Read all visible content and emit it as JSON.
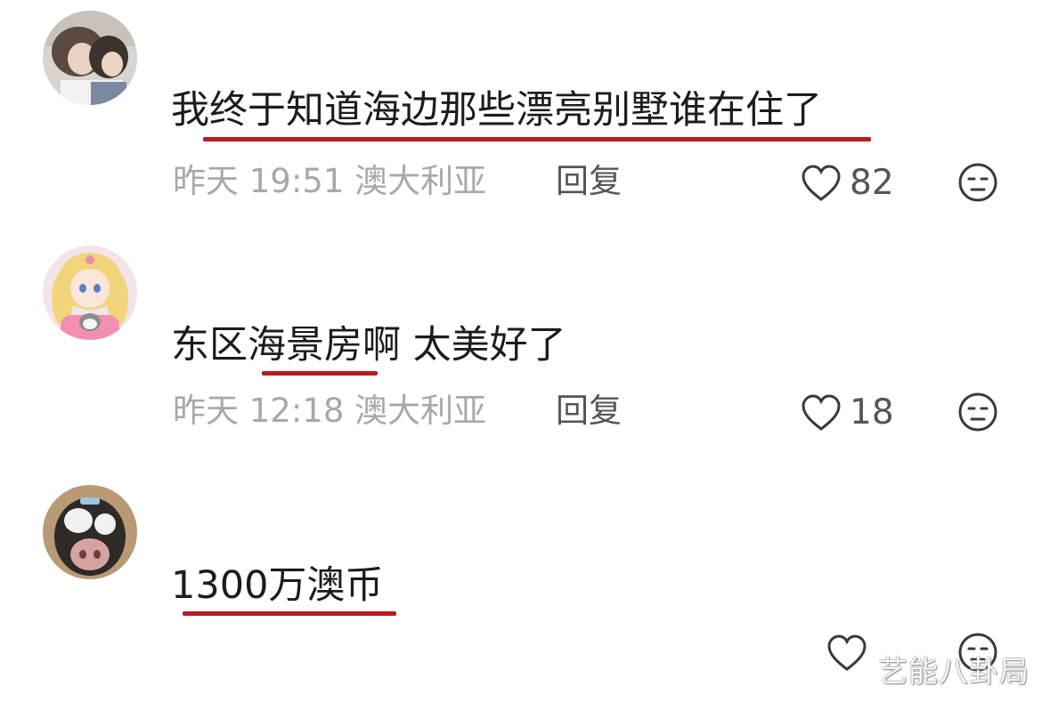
{
  "comments": [
    {
      "text": "我终于知道海边那些漂亮别墅谁在住了",
      "time": "昨天 19:51",
      "location": "澳大利亚",
      "reply_label": "回复",
      "likes": "82"
    },
    {
      "text": "东区海景房啊 太美好了",
      "time": "昨天 12:18",
      "location": "澳大利亚",
      "reply_label": "回复",
      "likes": "18"
    },
    {
      "text": "1300万澳币",
      "likes": ""
    }
  ],
  "icons": {
    "like": "heart-outline-icon",
    "dislike": "unamused-face-icon"
  },
  "colors": {
    "underline": "#b81c22",
    "meta_text": "#a8a8a8",
    "body_text": "#1c1c1c"
  },
  "watermark": "艺能八卦局"
}
